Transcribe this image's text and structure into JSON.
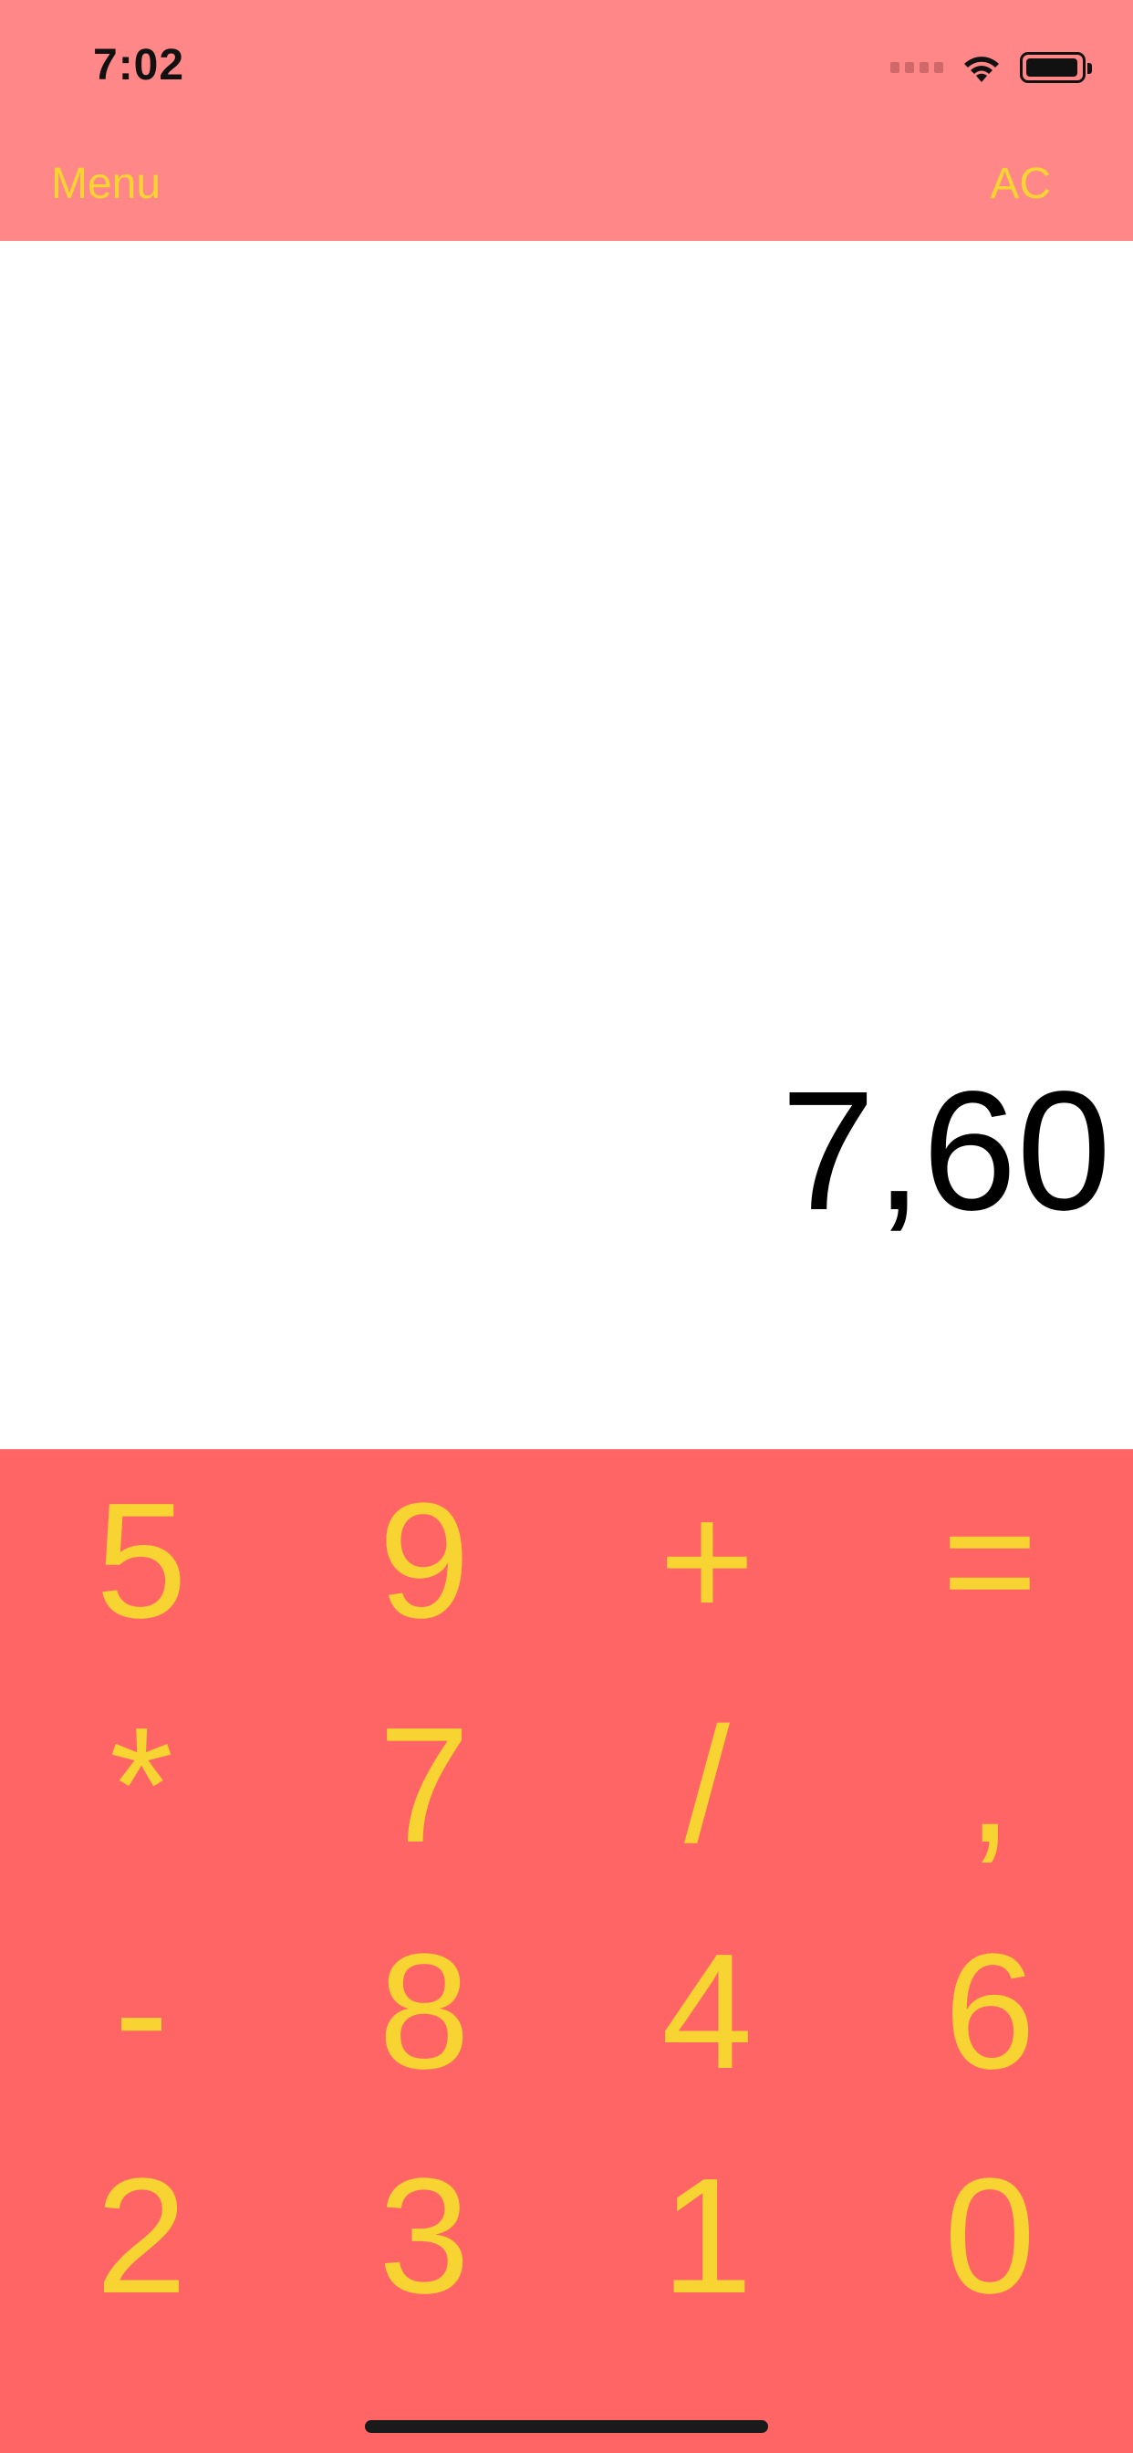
{
  "status_bar": {
    "time": "7:02"
  },
  "nav": {
    "left_label": "Menu",
    "right_label": "AC"
  },
  "display": {
    "value": "7,60"
  },
  "keypad": {
    "rows": [
      [
        "5",
        "9",
        "+",
        "="
      ],
      [
        "*",
        "7",
        "/",
        ","
      ],
      [
        "-",
        "8",
        "4",
        "6"
      ],
      [
        "2",
        "3",
        "1",
        "0"
      ]
    ]
  },
  "colors": {
    "topbar": "#ff8787",
    "keypad": "#ff6565",
    "accent_text": "#f7d432",
    "display_bg": "#ffffff"
  }
}
